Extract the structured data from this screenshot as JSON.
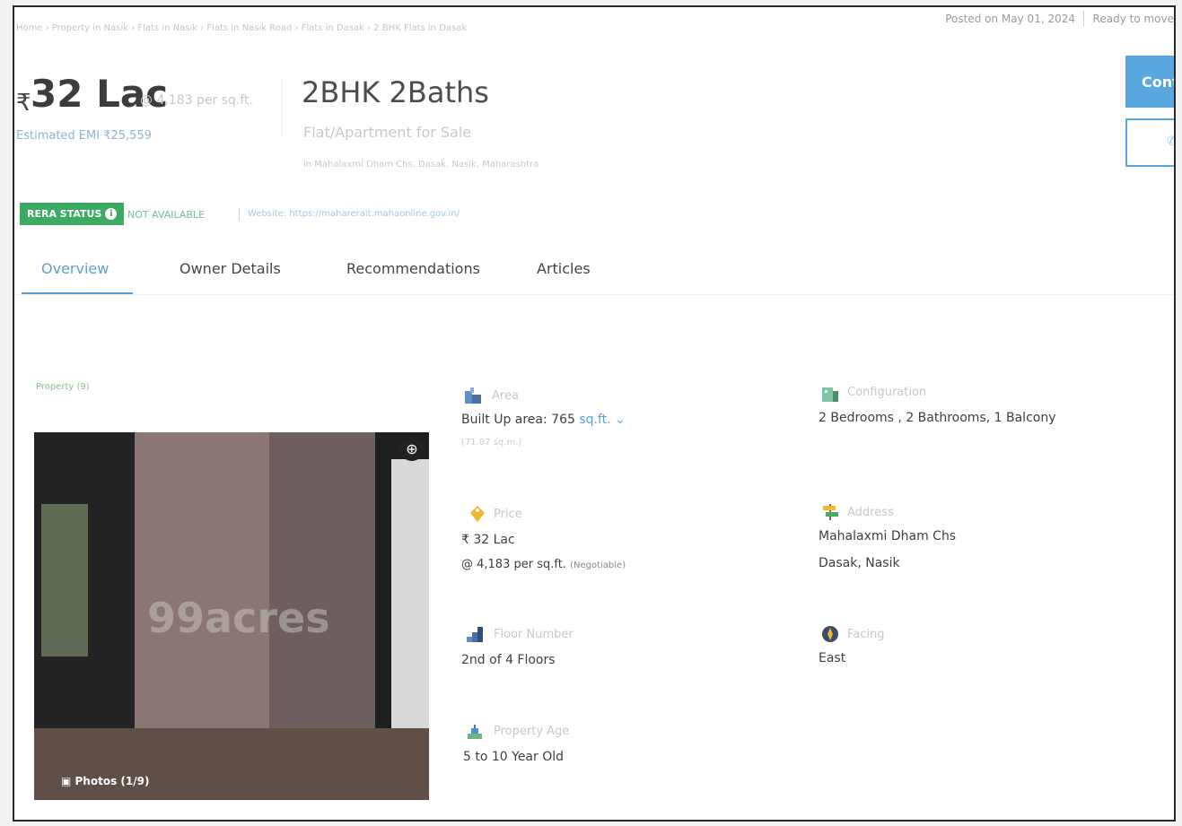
{
  "header": {
    "breadcrumb": "Home › Property in Nasik › Flats in Nasik › Flats in Nasik Road › Flats in Dasak › 2 BHK Flats in Dasak",
    "posted": "Posted on May 01, 2024",
    "ready": "Ready to move"
  },
  "price": {
    "currency": "₹",
    "amount": "32 Lac",
    "per_sqft": "@ 4,183 per sq.ft.",
    "emi": "Estimated EMI ₹25,559"
  },
  "listing": {
    "title": "2BHK 2Baths",
    "subtitle": "Flat/Apartment for Sale",
    "location": "in Mahalaxmi Dham Chs, Dasak, Nasik, Maharashtra"
  },
  "cta": {
    "contact": "Cont"
  },
  "rera": {
    "badge": "RERA STATUS",
    "status": "NOT AVAILABLE",
    "website": "Website: https://maharerait.mahaonline.gov.in/"
  },
  "tabs": [
    "Overview",
    "Owner Details",
    "Recommendations",
    "Articles"
  ],
  "gallery": {
    "label": "Property (9)",
    "watermark": "99acres",
    "photos": "Photos (1/9)"
  },
  "details": {
    "area": {
      "label": "Area",
      "value": "Built Up area: 765",
      "unit": "sq.ft.",
      "sub": "(71.07 sq.m.)"
    },
    "configuration": {
      "label": "Configuration",
      "value": "2 Bedrooms , 2 Bathrooms, 1 Balcony"
    },
    "price": {
      "label": "Price",
      "value": "₹ 32 Lac",
      "sub": "@ 4,183 per sq.ft.",
      "note": "(Negotiable)"
    },
    "address": {
      "label": "Address",
      "line1": "Mahalaxmi Dham Chs",
      "line2": "Dasak, Nasik"
    },
    "floor": {
      "label": "Floor Number",
      "value": "2nd",
      "of": "of 4 Floors"
    },
    "facing": {
      "label": "Facing",
      "value": "East"
    },
    "age": {
      "label": "Property Age",
      "value": "5 to 10 Year Old"
    }
  },
  "colors": {
    "accent": "#5a9fd6",
    "rera": "#3caa63"
  }
}
